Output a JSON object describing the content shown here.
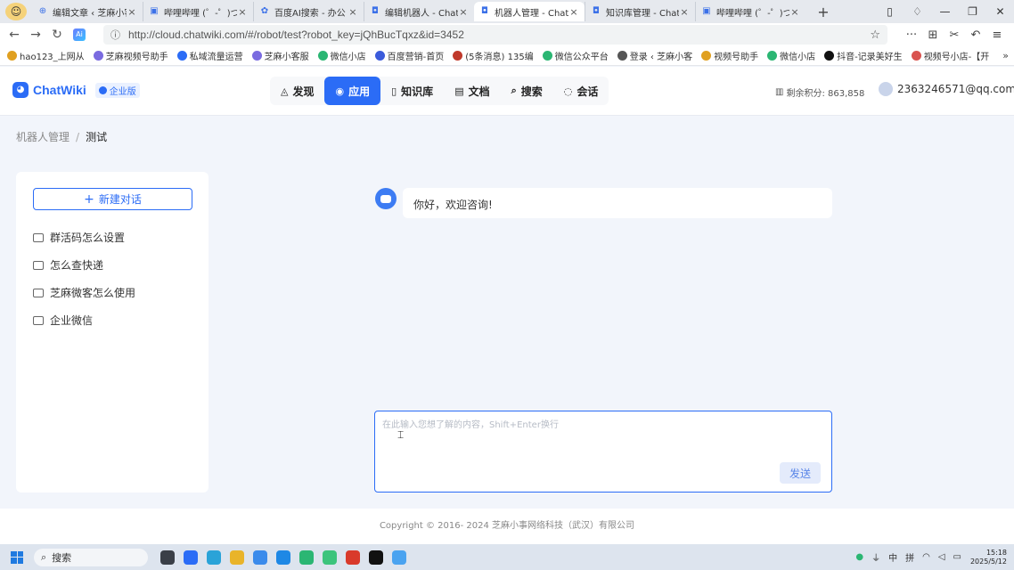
{
  "browser": {
    "tabs": [
      {
        "title": "编辑文章 ‹ 芝麻小客",
        "icon": "globe-icon",
        "active": false
      },
      {
        "title": "哔哩哔哩 (゜-゜)つロ",
        "icon": "bilibili-icon",
        "active": false
      },
      {
        "title": "百度AI搜索 - 办公",
        "icon": "baidu-icon",
        "active": false
      },
      {
        "title": "编辑机器人 - Chat",
        "icon": "chatwiki-icon",
        "active": false
      },
      {
        "title": "机器人管理 - Chat",
        "icon": "chatwiki-icon",
        "active": true
      },
      {
        "title": "知识库管理 - Chat",
        "icon": "chatwiki-icon",
        "active": false
      },
      {
        "title": "哔哩哔哩 (゜-゜)つ",
        "icon": "bilibili-icon",
        "active": false
      }
    ],
    "url": "http://cloud.chatwiki.com/#/robot/test?robot_key=jQhBucTqxz&id=3452",
    "bookmarks": [
      {
        "label": "hao123_上网从",
        "color": "#e0a020"
      },
      {
        "label": "芝麻视频号助手",
        "color": "#7a6be0"
      },
      {
        "label": "私域流量运营",
        "color": "#2b6cf6"
      },
      {
        "label": "芝麻小客服",
        "color": "#7a6be0"
      },
      {
        "label": "微信小店",
        "color": "#2bb673"
      },
      {
        "label": "百度营销-首页",
        "color": "#3b5bdb"
      },
      {
        "label": "(5条消息) 135编",
        "color": "#c0392b"
      },
      {
        "label": "微信公众平台",
        "color": "#2bb673"
      },
      {
        "label": "登录 ‹ 芝麻小客",
        "color": "#555555"
      },
      {
        "label": "视频号助手",
        "color": "#e0a020"
      },
      {
        "label": "微信小店",
        "color": "#2bb673"
      },
      {
        "label": "抖音-记录美好生",
        "color": "#111111"
      },
      {
        "label": "视频号小店-【开",
        "color": "#d9534f"
      }
    ]
  },
  "app": {
    "brand": "ChatWiki",
    "edition": "企业版",
    "nav": [
      {
        "label": "发现",
        "icon": "discover-icon",
        "active": false
      },
      {
        "label": "应用",
        "icon": "app-icon",
        "active": true
      },
      {
        "label": "知识库",
        "icon": "book-icon",
        "active": false
      },
      {
        "label": "文档",
        "icon": "doc-icon",
        "active": false
      },
      {
        "label": "搜索",
        "icon": "search-icon",
        "active": false
      },
      {
        "label": "会话",
        "icon": "chat-icon",
        "active": false
      }
    ],
    "points_label": "剩余积分: 863,858",
    "user_email": "2363246571@qq.com",
    "accent_color": "#2b6cf6"
  },
  "breadcrumb": {
    "parent": "机器人管理",
    "separator": "/",
    "current": "测试"
  },
  "sidebar": {
    "new_chat_label": "新建对话",
    "conversations": [
      {
        "label": "群活码怎么设置"
      },
      {
        "label": "怎么查快递"
      },
      {
        "label": "芝麻微客怎么使用"
      },
      {
        "label": "企业微信"
      }
    ]
  },
  "chat": {
    "welcome_message": "你好，欢迎咨询!",
    "input_placeholder": "在此输入您想了解的内容，Shift+Enter换行",
    "input_value": "",
    "send_label": "发送"
  },
  "footer": {
    "copyright": "Copyright © 2016- 2024 芝麻小事网络科技（武汉）有限公司"
  },
  "taskbar": {
    "search_label": "搜索",
    "time": "15:18",
    "date": "2025/5/12",
    "ime": "中",
    "ime2": "拼"
  }
}
